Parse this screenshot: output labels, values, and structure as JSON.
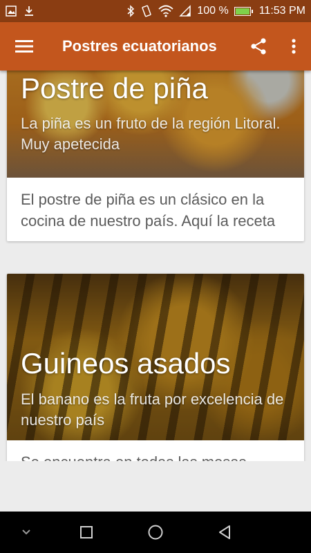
{
  "status_bar": {
    "battery_percent": "100 %",
    "time": "11:53 PM",
    "icons": [
      "image-icon",
      "download-icon",
      "bluetooth-icon",
      "vibrate-icon",
      "wifi-icon",
      "signal-icon",
      "battery-icon"
    ]
  },
  "app_bar": {
    "title": "Postres ecuatorianos",
    "icons": [
      "menu-icon",
      "share-icon",
      "more-vert-icon"
    ]
  },
  "cards": [
    {
      "title": "Postre de piña",
      "subtitle": "La piña es un fruto de la región Litoral. Muy apetecida",
      "body": "El postre de piña es un clásico en la cocina de nuestro país. Aquí la receta"
    },
    {
      "title": "Guineos asados",
      "subtitle": "El banano es la fruta por excelencia de nuestro país",
      "body": "Se encuentra en todas las mesas"
    }
  ],
  "nav_bar": {
    "icons": [
      "chevron-down-icon",
      "recents-icon",
      "home-icon",
      "back-icon"
    ]
  },
  "colors": {
    "status_bar": "#8a3d12",
    "app_bar": "#c3561d",
    "background": "#ececec",
    "nav_bar": "#000000"
  }
}
